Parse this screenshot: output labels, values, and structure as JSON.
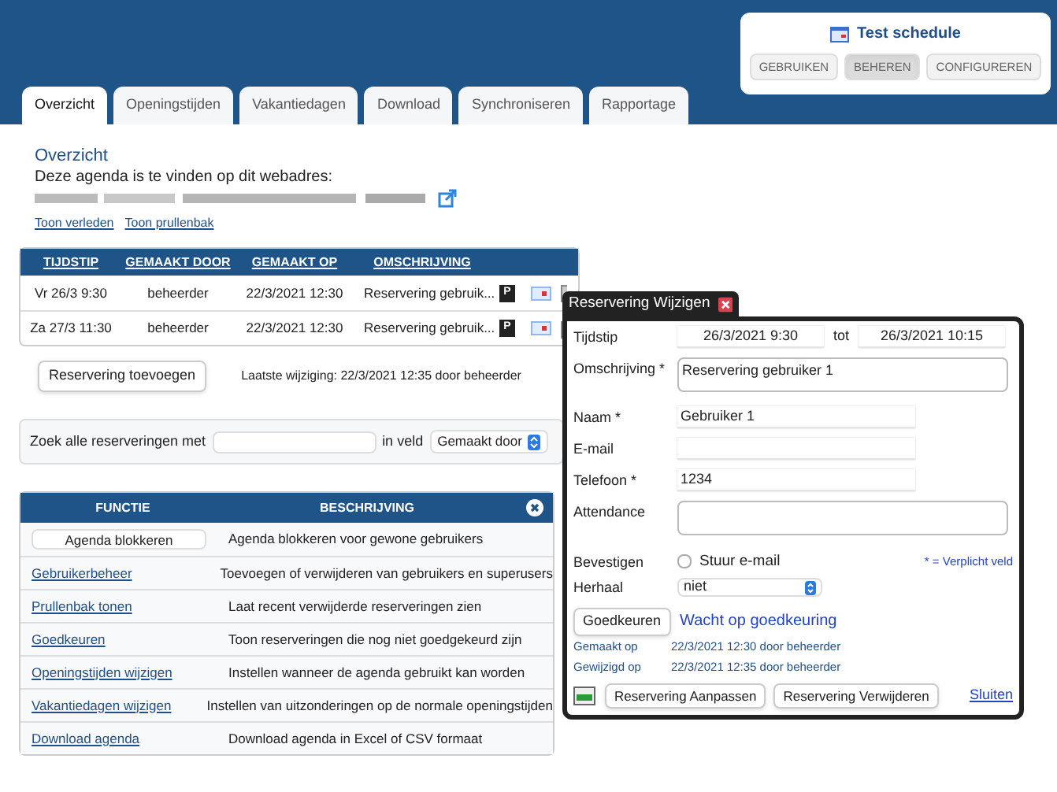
{
  "schedule_panel": {
    "title": "Test schedule",
    "buttons": [
      {
        "label": "GEBRUIKEN",
        "selected": false
      },
      {
        "label": "BEHEREN",
        "selected": true
      },
      {
        "label": "CONFIGUREREN",
        "selected": false
      }
    ]
  },
  "tabs": [
    {
      "label": "Overzicht",
      "selected": true
    },
    {
      "label": "Openingstijden",
      "selected": false
    },
    {
      "label": "Vakantiedagen",
      "selected": false
    },
    {
      "label": "Download",
      "selected": false
    },
    {
      "label": "Synchroniseren",
      "selected": false
    },
    {
      "label": "Rapportage",
      "selected": false
    }
  ],
  "overview": {
    "heading": "Overzicht",
    "address_label": "Deze agenda is te vinden op dit webadres:",
    "links": [
      "Toon verleden",
      "Toon prullenbak"
    ]
  },
  "reservations": {
    "columns": [
      "TIJDSTIP",
      "GEMAAKT DOOR",
      "GEMAAKT OP",
      "OMSCHRIJVING"
    ],
    "rows": [
      {
        "cells": [
          "Vr 26/3 9:30",
          "beheerder",
          "22/3/2021 12:30",
          "Reservering gebruik..."
        ],
        "badge": "P"
      },
      {
        "cells": [
          "Za 27/3 11:30",
          "beheerder",
          "22/3/2021 12:30",
          "Reservering gebruik..."
        ],
        "badge": "P"
      }
    ],
    "add_button": "Reservering toevoegen",
    "last_change": "Laatste wijziging: 22/3/2021 12:35 door beheerder"
  },
  "search": {
    "label": "Zoek alle reserveringen met",
    "field_label": "in veld",
    "select_value": "Gemaakt door"
  },
  "functions": {
    "columns": [
      "FUNCTIE",
      "BESCHRIJVING"
    ],
    "rows": [
      {
        "kind": "button",
        "function": "Agenda blokkeren",
        "description": "Agenda blokkeren voor gewone gebruikers"
      },
      {
        "kind": "link",
        "function": "Gebruikerbeheer",
        "description": "Toevoegen of verwijderen van gebruikers en superusers"
      },
      {
        "kind": "link",
        "function": "Prullenbak tonen",
        "description": "Laat recent verwijderde reserveringen zien"
      },
      {
        "kind": "link",
        "function": "Goedkeuren",
        "description": "Toon reserveringen die nog niet goedgekeurd zijn"
      },
      {
        "kind": "link",
        "function": "Openingstijden wijzigen",
        "description": "Instellen wanneer de agenda gebruikt kan worden"
      },
      {
        "kind": "link",
        "function": "Vakantiedagen wijzigen",
        "description": "Instellen van uitzonderingen op de normale openingstijden"
      },
      {
        "kind": "link",
        "function": "Download agenda",
        "description": "Download agenda in Excel of CSV formaat"
      }
    ]
  },
  "dialog": {
    "title": "Reservering Wijzigen",
    "fields": [
      {
        "kind": "range",
        "label": "Tijdstip",
        "value": "26/3/2021  9:30",
        "separator": "tot",
        "value_2": "26/3/2021  10:15"
      },
      {
        "kind": "textarea",
        "label": "Omschrijving *",
        "value": "Reservering gebruiker 1"
      },
      {
        "kind": "input",
        "label": "Naam *",
        "value": "Gebruiker 1"
      },
      {
        "kind": "input",
        "label": "E-mail"
      },
      {
        "kind": "input",
        "label": "Telefoon *",
        "value": "1234"
      },
      {
        "kind": "textarea",
        "label": "Attendance"
      },
      {
        "kind": "checkbox",
        "label": "Bevestigen",
        "option": "Stuur e-mail",
        "checked": false,
        "note": "* = Verplicht veld"
      },
      {
        "kind": "select",
        "label": "Herhaal",
        "value": "niet"
      }
    ],
    "approve_button": "Goedkeuren",
    "status": "Wacht op goedkeuring",
    "meta": [
      {
        "label": "Gemaakt op",
        "value": "22/3/2021 12:30 door beheerder"
      },
      {
        "label": "Gewijzigd op",
        "value": "22/3/2021 12:35 door beheerder"
      }
    ],
    "buttons": [
      "Reservering Aanpassen",
      "Reservering Verwijderen"
    ],
    "close_link": "Sluiten"
  }
}
